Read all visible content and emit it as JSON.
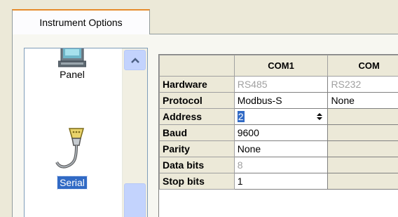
{
  "tab": {
    "label": "Instrument Options"
  },
  "list": {
    "items": [
      {
        "label": "Panel",
        "icon": "panel-icon",
        "selected": false
      },
      {
        "label": "Serial",
        "icon": "serial-port-icon",
        "selected": true
      }
    ]
  },
  "grid": {
    "columns": [
      "",
      "COM1",
      "COM"
    ],
    "rows": [
      {
        "label": "Hardware",
        "com1": "RS485",
        "com2": "RS232"
      },
      {
        "label": "Protocol",
        "com1": "Modbus-S",
        "com2": "None"
      },
      {
        "label": "Address",
        "com1": "2",
        "com2": ""
      },
      {
        "label": "Baud",
        "com1": "9600",
        "com2": ""
      },
      {
        "label": "Parity",
        "com1": "None",
        "com2": ""
      },
      {
        "label": "Data bits",
        "com1": "8",
        "com2": ""
      },
      {
        "label": "Stop bits",
        "com1": "1",
        "com2": ""
      }
    ]
  },
  "colors": {
    "selection": "#316ac5",
    "tab_accent": "#e68b2c",
    "header_bg": "#ece9d8"
  }
}
